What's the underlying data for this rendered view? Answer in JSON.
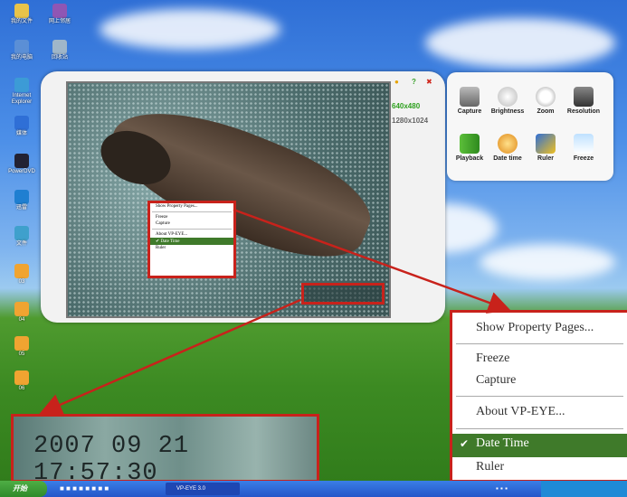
{
  "desktop": {
    "icons": [
      {
        "name": "folder",
        "label": "我的文件"
      },
      {
        "name": "network",
        "label": "网上邻居"
      },
      {
        "name": "computer",
        "label": "我的电脑"
      },
      {
        "name": "recycle",
        "label": "回收站"
      },
      {
        "name": "ie",
        "label": "Internet Explorer"
      },
      {
        "name": "media",
        "label": "媒体"
      },
      {
        "name": "app1",
        "label": "PowerDVD"
      },
      {
        "name": "app2",
        "label": "迅雷"
      },
      {
        "name": "app3",
        "label": "文件"
      },
      {
        "name": "doc1",
        "label": "03"
      },
      {
        "name": "doc2",
        "label": "04"
      },
      {
        "name": "doc3",
        "label": "05"
      },
      {
        "name": "doc4",
        "label": "06"
      }
    ]
  },
  "app": {
    "controls": {
      "help": "?",
      "close": "✖"
    },
    "resolutions": [
      "640x480",
      "1280x1024"
    ],
    "context_menu": {
      "items": [
        "Show Property Pages...",
        "Freeze",
        "Capture",
        "About VP-EYE...",
        "Date Time",
        "Ruler"
      ],
      "checked": "Date Time"
    }
  },
  "toolbar": {
    "buttons": [
      {
        "label": "Capture",
        "icon": "camera-icon"
      },
      {
        "label": "Brightness",
        "icon": "bulb-icon"
      },
      {
        "label": "Zoom",
        "icon": "magnifier-icon"
      },
      {
        "label": "Resolution",
        "icon": "monitor-icon"
      },
      {
        "label": "Playback",
        "icon": "play-icon"
      },
      {
        "label": "Date time",
        "icon": "clock-icon"
      },
      {
        "label": "Ruler",
        "icon": "ruler-icon"
      },
      {
        "label": "Freeze",
        "icon": "snowman-icon"
      }
    ]
  },
  "zoom_overlay": {
    "timestamp": "2007 09 21  17:57:30"
  },
  "taskbar": {
    "start": "开始",
    "task": "VP-EYE 3.0"
  },
  "colors": {
    "highlight": "#c8221b",
    "menu_selected": "#3f7a2a"
  }
}
